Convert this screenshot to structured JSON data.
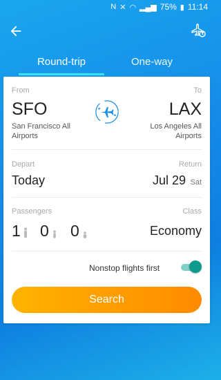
{
  "status_bar": {
    "battery": "75%",
    "time": "11:14"
  },
  "tabs": [
    {
      "label": "Round-trip"
    },
    {
      "label": "One-way"
    }
  ],
  "route": {
    "from_label": "From",
    "from_code": "SFO",
    "from_name": "San Francisco All Airports",
    "to_label": "To",
    "to_code": "LAX",
    "to_name": "Los Angeles  All Airports"
  },
  "dates": {
    "depart_label": "Depart",
    "depart_value": "Today",
    "return_label": "Return",
    "return_value": "Jul 29",
    "return_day": "Sat"
  },
  "passengers": {
    "label": "Passengers",
    "adults": "1",
    "children": "0",
    "infants": "0"
  },
  "class": {
    "label": "Class",
    "value": "Economy"
  },
  "nonstop": {
    "label": "Nonstop flights first",
    "enabled": true
  },
  "search_label": "Search",
  "colors": {
    "accent": "#1a8fe6",
    "search_start": "#ffb300",
    "search_end": "#ff8a00",
    "toggle": "#0e9b8e"
  }
}
